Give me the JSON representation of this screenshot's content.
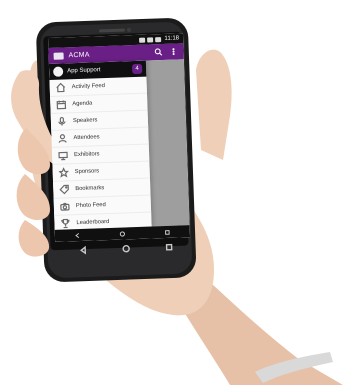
{
  "status_bar": {
    "time": "11:18"
  },
  "app": {
    "title": "ACMA"
  },
  "drawer": {
    "header_title": "App Support",
    "header_badge": "4",
    "items": [
      {
        "label": "Activity Feed",
        "icon": "home-icon"
      },
      {
        "label": "Agenda",
        "icon": "calendar-icon"
      },
      {
        "label": "Speakers",
        "icon": "microphone-icon"
      },
      {
        "label": "Attendees",
        "icon": "attendees-icon"
      },
      {
        "label": "Exhibitors",
        "icon": "exhibitors-icon"
      },
      {
        "label": "Sponsors",
        "icon": "star-icon"
      },
      {
        "label": "Bookmarks",
        "icon": "bookmark-tag-icon"
      },
      {
        "label": "Photo Feed",
        "icon": "camera-icon"
      },
      {
        "label": "Leaderboard",
        "icon": "trophy-icon"
      }
    ]
  },
  "colors": {
    "accent": "#6a1f86",
    "appbar": "#6a1f86",
    "drawer_header": "#0f0f12"
  }
}
